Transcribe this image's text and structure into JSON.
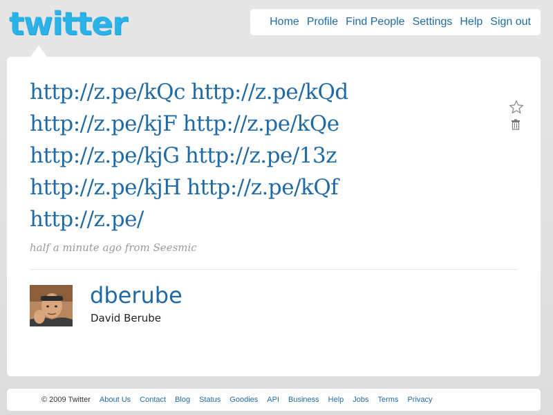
{
  "logo": {
    "text": "twitter"
  },
  "nav": {
    "items": [
      {
        "label": "Home"
      },
      {
        "label": "Profile"
      },
      {
        "label": "Find People"
      },
      {
        "label": "Settings"
      },
      {
        "label": "Help"
      },
      {
        "label": "Sign out"
      }
    ]
  },
  "tweet": {
    "links": [
      "http://z.pe/kQc",
      "http://z.pe/kQd",
      "http://z.pe/kjF",
      "http://z.pe/kQe",
      "http://z.pe/kjG",
      "http://z.pe/13z",
      "http://z.pe/kjH",
      "http://z.pe/kQf",
      "http://z.pe/"
    ],
    "meta": "half a minute ago from Seesmic",
    "icons": {
      "favorite": "star-icon",
      "delete": "trash-icon"
    }
  },
  "author": {
    "username": "dberube",
    "full_name": "David Berube"
  },
  "footer": {
    "copyright": "© 2009 Twitter",
    "links": [
      {
        "label": "About Us"
      },
      {
        "label": "Contact"
      },
      {
        "label": "Blog"
      },
      {
        "label": "Status"
      },
      {
        "label": "Goodies"
      },
      {
        "label": "API"
      },
      {
        "label": "Business"
      },
      {
        "label": "Help"
      },
      {
        "label": "Jobs"
      },
      {
        "label": "Terms"
      },
      {
        "label": "Privacy"
      }
    ]
  },
  "colors": {
    "link": "#1f6aa5",
    "logo": "#2bb2e6",
    "background": "#e0e0e0",
    "meta": "#999999"
  }
}
